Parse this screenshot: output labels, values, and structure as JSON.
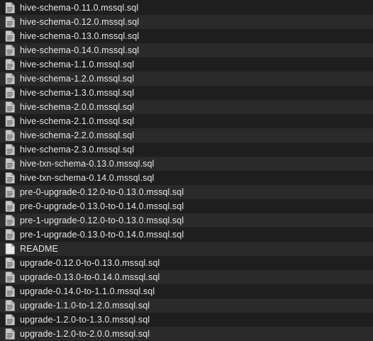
{
  "files": [
    {
      "name": "hive-schema-0.11.0.mssql.sql",
      "icon": "sql-file-icon"
    },
    {
      "name": "hive-schema-0.12.0.mssql.sql",
      "icon": "sql-file-icon"
    },
    {
      "name": "hive-schema-0.13.0.mssql.sql",
      "icon": "sql-file-icon"
    },
    {
      "name": "hive-schema-0.14.0.mssql.sql",
      "icon": "sql-file-icon"
    },
    {
      "name": "hive-schema-1.1.0.mssql.sql",
      "icon": "sql-file-icon"
    },
    {
      "name": "hive-schema-1.2.0.mssql.sql",
      "icon": "sql-file-icon"
    },
    {
      "name": "hive-schema-1.3.0.mssql.sql",
      "icon": "sql-file-icon"
    },
    {
      "name": "hive-schema-2.0.0.mssql.sql",
      "icon": "sql-file-icon"
    },
    {
      "name": "hive-schema-2.1.0.mssql.sql",
      "icon": "sql-file-icon"
    },
    {
      "name": "hive-schema-2.2.0.mssql.sql",
      "icon": "sql-file-icon"
    },
    {
      "name": "hive-schema-2.3.0.mssql.sql",
      "icon": "sql-file-icon"
    },
    {
      "name": "hive-txn-schema-0.13.0.mssql.sql",
      "icon": "sql-file-icon"
    },
    {
      "name": "hive-txn-schema-0.14.0.mssql.sql",
      "icon": "sql-file-icon"
    },
    {
      "name": "pre-0-upgrade-0.12.0-to-0.13.0.mssql.sql",
      "icon": "sql-file-icon"
    },
    {
      "name": "pre-0-upgrade-0.13.0-to-0.14.0.mssql.sql",
      "icon": "sql-file-icon"
    },
    {
      "name": "pre-1-upgrade-0.12.0-to-0.13.0.mssql.sql",
      "icon": "sql-file-icon"
    },
    {
      "name": "pre-1-upgrade-0.13.0-to-0.14.0.mssql.sql",
      "icon": "sql-file-icon"
    },
    {
      "name": "README",
      "icon": "plain-file-icon"
    },
    {
      "name": "upgrade-0.12.0-to-0.13.0.mssql.sql",
      "icon": "sql-file-icon"
    },
    {
      "name": "upgrade-0.13.0-to-0.14.0.mssql.sql",
      "icon": "sql-file-icon"
    },
    {
      "name": "upgrade-0.14.0-to-1.1.0.mssql.sql",
      "icon": "sql-file-icon"
    },
    {
      "name": "upgrade-1.1.0-to-1.2.0.mssql.sql",
      "icon": "sql-file-icon"
    },
    {
      "name": "upgrade-1.2.0-to-1.3.0.mssql.sql",
      "icon": "sql-file-icon"
    },
    {
      "name": "upgrade-1.2.0-to-2.0.0.mssql.sql",
      "icon": "sql-file-icon"
    }
  ]
}
